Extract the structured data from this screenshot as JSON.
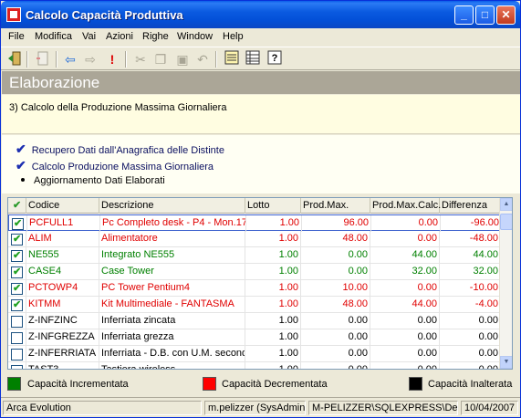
{
  "window": {
    "title": "Calcolo Capacità Produttiva",
    "min_label": "_",
    "max_label": "□",
    "close_label": "✕"
  },
  "menu": [
    "File",
    "Modifica",
    "Vai",
    "Azioni",
    "Righe",
    "Window",
    "Help"
  ],
  "toolbar": {
    "icons": [
      "exit-icon",
      "new-doc-icon",
      "back-arrow-icon",
      "forward-arrow-icon",
      "exclamation-icon",
      "cut-icon",
      "copy-icon",
      "paste-icon",
      "undo-icon",
      "list-icon",
      "table-icon",
      "help-icon"
    ]
  },
  "header": {
    "title": "Elaborazione"
  },
  "step": {
    "text": "3) Calcolo della Produzione Massima Giornaliera"
  },
  "steps": [
    {
      "label": "Recupero Dati dall'Anagrafica delle Distinte",
      "done": true
    },
    {
      "label": "Calcolo Produzione Massima Giornaliera",
      "done": true
    },
    {
      "label": "Aggiornamento Dati Elaborati",
      "done": false
    }
  ],
  "grid": {
    "check_header": "✔",
    "columns": [
      "Codice",
      "Descrizione",
      "Lotto",
      "Prod.Max.",
      "Prod.Max.Calc.",
      "Differenza"
    ],
    "rows": [
      {
        "checked": true,
        "color": "#e00000",
        "codice": "PCFULL1",
        "descrizione": "Pc Completo desk - P4 - Mon.17\"",
        "lotto": "1.00",
        "prodmax": "96.00",
        "calc": "0.00",
        "diff": "-96.00"
      },
      {
        "checked": true,
        "color": "#e00000",
        "codice": "ALIM",
        "descrizione": "Alimentatore",
        "lotto": "1.00",
        "prodmax": "48.00",
        "calc": "0.00",
        "diff": "-48.00"
      },
      {
        "checked": true,
        "color": "#008000",
        "codice": "NE555",
        "descrizione": "Integrato NE555",
        "lotto": "1.00",
        "prodmax": "0.00",
        "calc": "44.00",
        "diff": "44.00"
      },
      {
        "checked": true,
        "color": "#008000",
        "codice": "CASE4",
        "descrizione": "Case Tower",
        "lotto": "1.00",
        "prodmax": "0.00",
        "calc": "32.00",
        "diff": "32.00"
      },
      {
        "checked": true,
        "color": "#e00000",
        "codice": "PCTOWP4",
        "descrizione": "PC Tower Pentium4",
        "lotto": "1.00",
        "prodmax": "10.00",
        "calc": "0.00",
        "diff": "-10.00"
      },
      {
        "checked": true,
        "color": "#e00000",
        "codice": "KITMM",
        "descrizione": "Kit Multimediale - FANTASMA",
        "lotto": "1.00",
        "prodmax": "48.00",
        "calc": "44.00",
        "diff": "-4.00"
      },
      {
        "checked": false,
        "color": "#000000",
        "codice": "Z-INFZINC",
        "descrizione": "Inferriata zincata",
        "lotto": "1.00",
        "prodmax": "0.00",
        "calc": "0.00",
        "diff": "0.00"
      },
      {
        "checked": false,
        "color": "#000000",
        "codice": "Z-INFGREZZA",
        "descrizione": "Inferriata grezza",
        "lotto": "1.00",
        "prodmax": "0.00",
        "calc": "0.00",
        "diff": "0.00"
      },
      {
        "checked": false,
        "color": "#000000",
        "codice": "Z-INFERRIATA",
        "descrizione": "Inferriata - D.B. con U.M. second",
        "lotto": "1.00",
        "prodmax": "0.00",
        "calc": "0.00",
        "diff": "0.00"
      },
      {
        "checked": false,
        "color": "#000000",
        "codice": "TAST3",
        "descrizione": "Tastiera wireless",
        "lotto": "1.00",
        "prodmax": "0.00",
        "calc": "0.00",
        "diff": "0.00"
      }
    ]
  },
  "legend": [
    {
      "color": "#008000",
      "label": "Capacità Incrementata"
    },
    {
      "color": "#ff0000",
      "label": "Capacità Decrementata"
    },
    {
      "color": "#000000",
      "label": "Capacità Inalterata"
    }
  ],
  "status": [
    "Arca Evolution",
    "m.pelizzer (SysAdmin)",
    "M-PELIZZER\\SQLEXPRESS\\Demo",
    "10/04/2007"
  ]
}
